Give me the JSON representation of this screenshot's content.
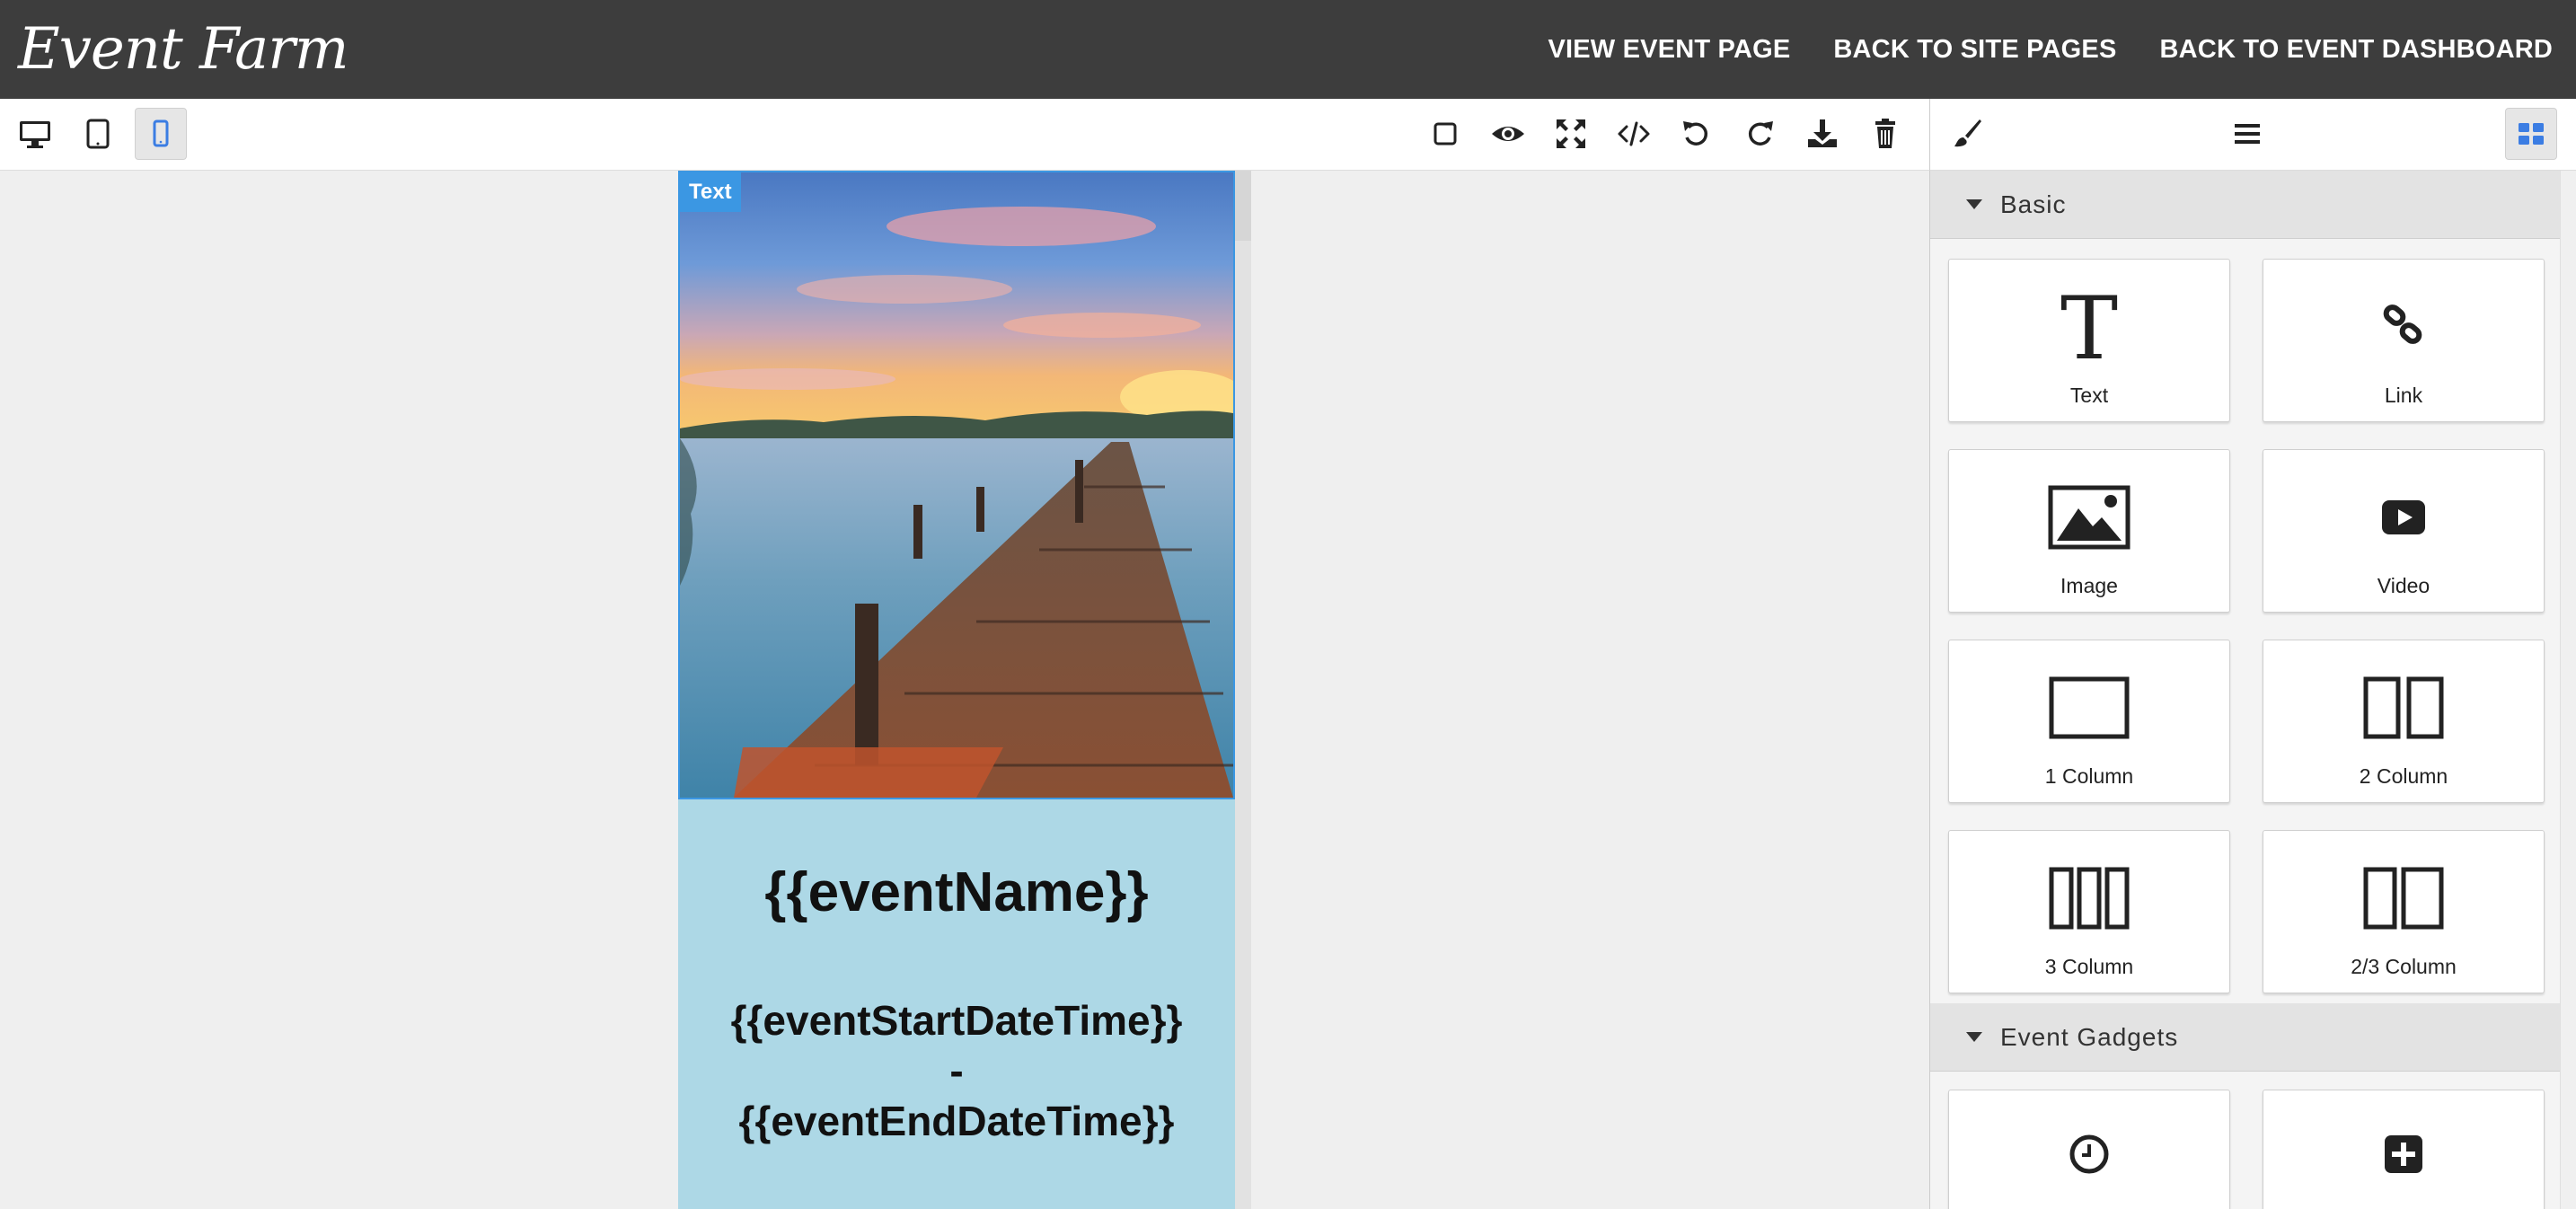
{
  "header": {
    "logo_text": "Event Farm",
    "nav": [
      "VIEW EVENT PAGE",
      "BACK TO SITE PAGES",
      "BACK TO EVENT DASHBOARD"
    ]
  },
  "toolbar": {
    "devices": [
      "desktop-icon",
      "tablet-icon",
      "mobile-icon"
    ],
    "active_device": "mobile",
    "actions": [
      "square-outline-icon",
      "eye-icon",
      "fullscreen-icon",
      "code-icon",
      "undo-icon",
      "redo-icon",
      "download-icon",
      "trash-icon"
    ]
  },
  "panel_tabs": [
    "paintbrush-icon",
    "hamburger-icon",
    "blocks-grid-icon"
  ],
  "canvas": {
    "selected_badge": "Text",
    "event_name": "{{eventName}}",
    "date_line_1": "{{eventStartDateTime}}",
    "date_separator": "-",
    "date_line_2": "{{eventEndDateTime}}",
    "background_color": "#add8e6"
  },
  "blocks": {
    "basic_title": "Basic",
    "basic_items": [
      {
        "label": "Text",
        "icon": "text-icon"
      },
      {
        "label": "Link",
        "icon": "link-icon"
      },
      {
        "label": "Image",
        "icon": "image-icon"
      },
      {
        "label": "Video",
        "icon": "video-icon"
      },
      {
        "label": "1 Column",
        "icon": "one-column-icon"
      },
      {
        "label": "2 Column",
        "icon": "two-column-icon"
      },
      {
        "label": "3 Column",
        "icon": "three-column-icon"
      },
      {
        "label": "2/3 Column",
        "icon": "two-thirds-column-icon"
      }
    ],
    "gadgets_title": "Event Gadgets",
    "gadget_items": [
      {
        "label": "",
        "icon": "clock-icon"
      },
      {
        "label": "",
        "icon": "plus-square-icon"
      }
    ]
  },
  "colors": {
    "header_bg": "#3d3d3d",
    "accent": "#3b97e3",
    "active_device": "#3b7de3"
  }
}
